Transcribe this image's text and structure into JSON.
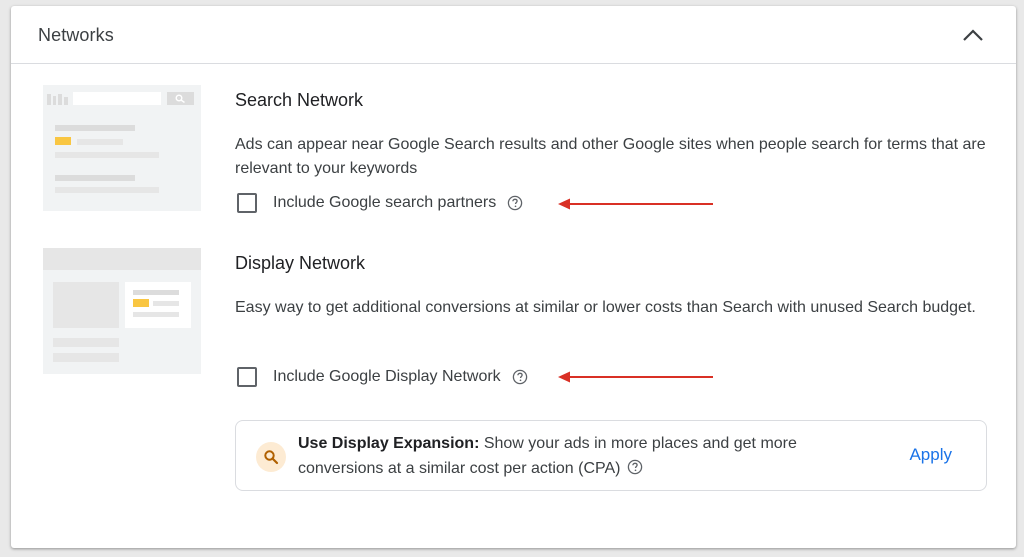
{
  "panel": {
    "title": "Networks"
  },
  "search_network": {
    "title": "Search Network",
    "description": "Ads can appear near Google Search results and other Google sites when people search for terms that are relevant to your keywords",
    "option_label": "Include Google search partners",
    "checked": false
  },
  "display_network": {
    "title": "Display Network",
    "description": "Easy way to get additional conversions at similar or lower costs than Search with unused Search budget.",
    "option_label": "Include Google Display Network",
    "checked": false
  },
  "display_expansion": {
    "bold_label": "Use Display Expansion:",
    "text": " Show your ads in more places and get more conversions at a similar cost per action (CPA)",
    "apply_label": "Apply"
  },
  "icons": [
    "chevron-up-icon",
    "help-icon",
    "search-icon",
    "arrow-icon"
  ],
  "colors": {
    "accent": "#1a73e8",
    "annotation_arrow": "#d93025",
    "highlight_yellow": "#f9c642"
  }
}
